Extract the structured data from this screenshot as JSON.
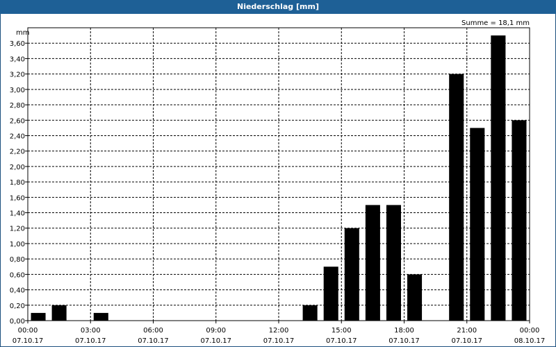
{
  "header": {
    "title": "Niederschlag [mm]"
  },
  "chart_data": {
    "type": "bar",
    "title": "Niederschlag [mm]",
    "ylabel": "mm",
    "annotation": "Summe = 18,1 mm",
    "ylim": [
      0,
      3.8
    ],
    "yticks": [
      "0,00",
      "0,20",
      "0,40",
      "0,60",
      "0,80",
      "1,00",
      "1,20",
      "1,40",
      "1,60",
      "1,80",
      "2,00",
      "2,20",
      "2,40",
      "2,60",
      "2,80",
      "3,00",
      "3,20",
      "3,40",
      "3,60"
    ],
    "xticks": [
      {
        "time": "00:00",
        "date": "07.10.17"
      },
      {
        "time": "03:00",
        "date": "07.10.17"
      },
      {
        "time": "06:00",
        "date": "07.10.17"
      },
      {
        "time": "09:00",
        "date": "07.10.17"
      },
      {
        "time": "12:00",
        "date": "07.10.17"
      },
      {
        "time": "15:00",
        "date": "07.10.17"
      },
      {
        "time": "18:00",
        "date": "07.10.17"
      },
      {
        "time": "21:00",
        "date": "07.10.17"
      },
      {
        "time": "00:00",
        "date": "08.10.17"
      }
    ],
    "categories": [
      "00:00",
      "01:00",
      "02:00",
      "03:00",
      "04:00",
      "05:00",
      "06:00",
      "07:00",
      "08:00",
      "09:00",
      "10:00",
      "11:00",
      "12:00",
      "13:00",
      "14:00",
      "15:00",
      "16:00",
      "17:00",
      "18:00",
      "19:00",
      "20:00",
      "21:00",
      "22:00",
      "23:00"
    ],
    "values": [
      0.1,
      0.2,
      0,
      0.1,
      0,
      0,
      0,
      0,
      0,
      0,
      0,
      0,
      0,
      0.2,
      0.7,
      1.2,
      1.5,
      1.5,
      0.6,
      0,
      3.2,
      2.5,
      3.7,
      2.6
    ],
    "grid": true,
    "bar_color": "#000000"
  }
}
